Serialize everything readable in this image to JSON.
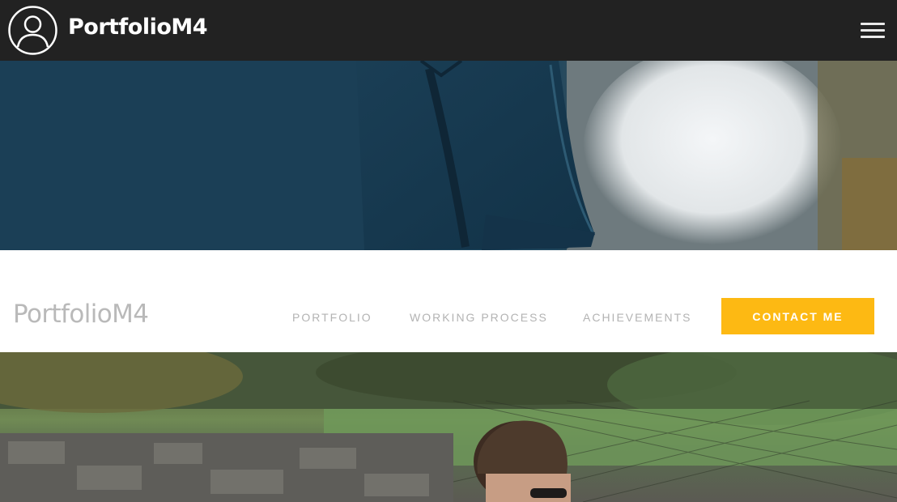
{
  "header": {
    "brand": "PortfolioM4",
    "icons": {
      "avatar": "user-avatar-icon",
      "menu": "hamburger-menu-icon"
    }
  },
  "hero": {
    "image": "denim-jacket-photo"
  },
  "nav": {
    "brand": "PortfolioM4",
    "links": [
      "PORTFOLIO",
      "WORKING PROCESS",
      "ACHIEVEMENTS"
    ],
    "cta": "CONTACT ME"
  },
  "photo": {
    "image": "person-by-fence-photo"
  },
  "colors": {
    "header_bg": "#222222",
    "accent": "#fdb913",
    "nav_text": "#b3b3b3",
    "brand_light": "#b9b9b9"
  }
}
